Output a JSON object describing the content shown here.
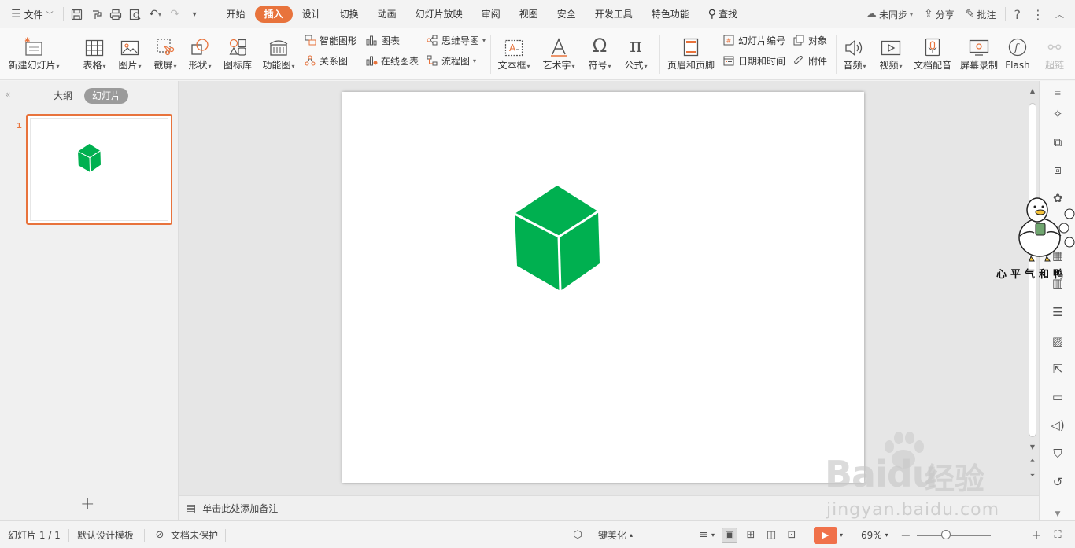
{
  "menubar": {
    "file_label": "文件",
    "tabs": [
      "开始",
      "插入",
      "设计",
      "切换",
      "动画",
      "幻灯片放映",
      "审阅",
      "视图",
      "安全",
      "开发工具",
      "特色功能"
    ],
    "active_tab": "插入",
    "search_label": "查找",
    "sync_label": "未同步",
    "share_label": "分享",
    "comment_label": "批注",
    "help_icon": "?"
  },
  "ribbon": {
    "new_slide": "新建幻灯片",
    "table": "表格",
    "picture": "图片",
    "screenshot": "截屏",
    "shape": "形状",
    "icon_lib": "图标库",
    "func_chart": "功能图",
    "smart_art": "智能图形",
    "chart": "图表",
    "relation": "关系图",
    "online_chart": "在线图表",
    "mind_map": "思维导图",
    "flow_chart": "流程图",
    "text_box": "文本框",
    "word_art": "艺术字",
    "symbol": "符号",
    "formula": "公式",
    "header_footer": "页眉和页脚",
    "slide_number": "幻灯片编号",
    "object": "对象",
    "date_time": "日期和时间",
    "attachment": "附件",
    "audio": "音频",
    "video": "视频",
    "doc_dub": "文档配音",
    "screen_rec": "屏幕录制",
    "flash": "Flash",
    "hyperlink": "超链"
  },
  "leftpanel": {
    "outline_tab": "大纲",
    "slides_tab": "幻灯片",
    "thumb_number": "1",
    "add_icon": "+"
  },
  "notes": {
    "placeholder": "单击此处添加备注"
  },
  "statusbar": {
    "slide_counter": "幻灯片 1 / 1",
    "template": "默认设计模板",
    "protect": "文档未保护",
    "beautify": "一键美化",
    "zoom": "69%",
    "zoom_level": 0.69
  },
  "mascot": {
    "caption": "心平气和鸭"
  },
  "watermark": {
    "brand": "Baidu",
    "service": "经验",
    "url": "jingyan.baidu.com"
  },
  "colors": {
    "accent": "#e8733c",
    "cube": "#00b050",
    "play": "#f0714a"
  }
}
